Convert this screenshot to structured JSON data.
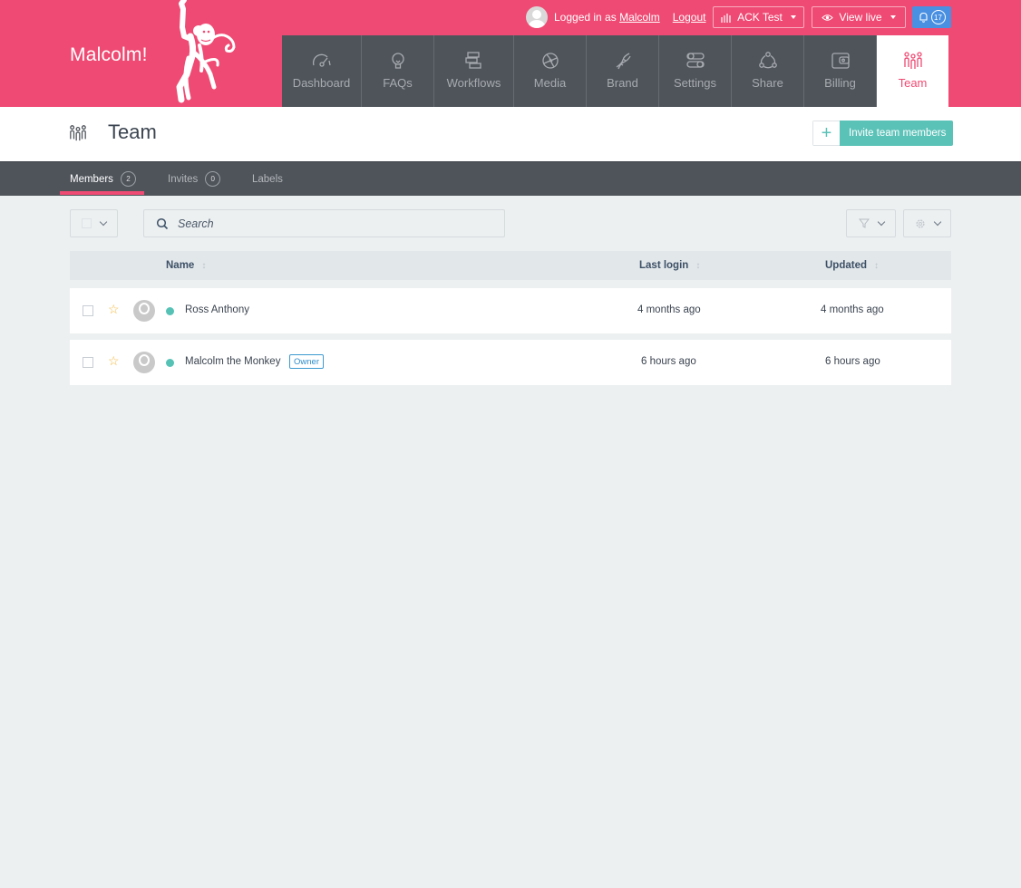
{
  "brand": {
    "name": "Malcolm!",
    "logo": "monkey-logo",
    "accent": "#ef4a73"
  },
  "userbar": {
    "prefix": "Logged in as",
    "username": "Malcolm",
    "logout": "Logout",
    "account_button": "ACK Test",
    "view_live_button": "View live",
    "notification_count": "17"
  },
  "nav": {
    "items": [
      {
        "label": "Dashboard",
        "icon": "gauge-icon"
      },
      {
        "label": "FAQs",
        "icon": "lightbulb-icon"
      },
      {
        "label": "Workflows",
        "icon": "workflow-icon"
      },
      {
        "label": "Media",
        "icon": "aperture-icon"
      },
      {
        "label": "Brand",
        "icon": "dna-icon"
      },
      {
        "label": "Settings",
        "icon": "toggles-icon"
      },
      {
        "label": "Share",
        "icon": "share-icon"
      },
      {
        "label": "Billing",
        "icon": "wallet-icon"
      },
      {
        "label": "Team",
        "icon": "team-icon",
        "active": true
      }
    ]
  },
  "page": {
    "title": "Team",
    "invite_button": "Invite team members"
  },
  "tabs": [
    {
      "label": "Members",
      "count": "2",
      "active": true
    },
    {
      "label": "Invites",
      "count": "0"
    },
    {
      "label": "Labels"
    }
  ],
  "toolbar": {
    "search_placeholder": "Search"
  },
  "table": {
    "columns": [
      "Name",
      "Last login",
      "Updated"
    ],
    "rows": [
      {
        "name": "Ross Anthony",
        "last_login": "4 months ago",
        "updated": "4 months ago",
        "badge": null,
        "status": "online"
      },
      {
        "name": "Malcolm the Monkey",
        "last_login": "6 hours ago",
        "updated": "6 hours ago",
        "badge": "Owner",
        "status": "online"
      }
    ]
  }
}
